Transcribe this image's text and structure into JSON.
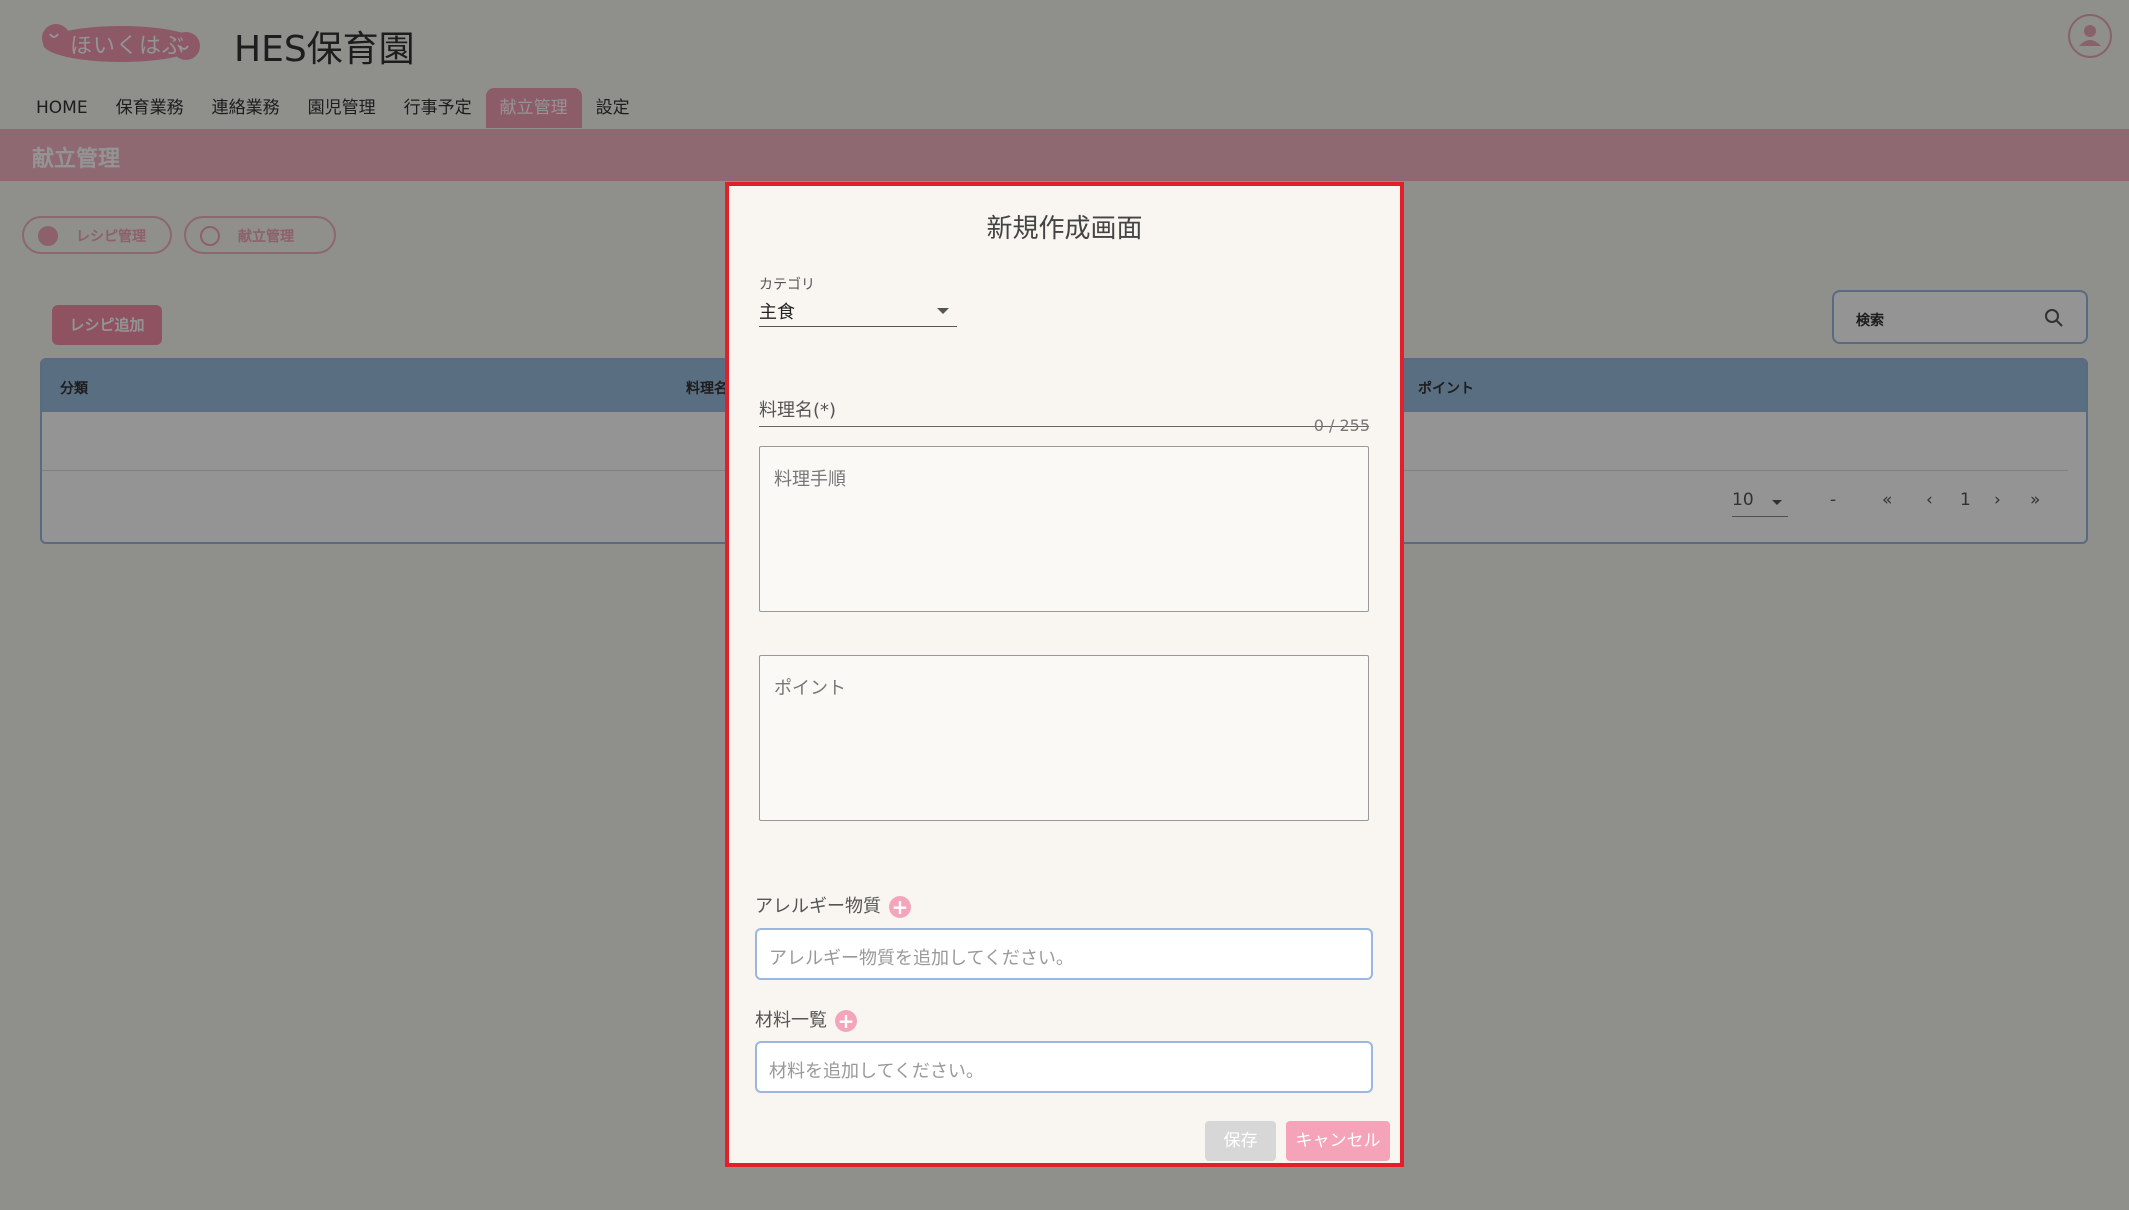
{
  "header": {
    "logo_text": "ほいくはぶ",
    "site_title": "HES保育園"
  },
  "nav": {
    "items": [
      {
        "label": "HOME",
        "active": false
      },
      {
        "label": "保育業務",
        "active": false
      },
      {
        "label": "連絡業務",
        "active": false
      },
      {
        "label": "園児管理",
        "active": false
      },
      {
        "label": "行事予定",
        "active": false
      },
      {
        "label": "献立管理",
        "active": true
      },
      {
        "label": "設定",
        "active": false
      }
    ]
  },
  "banner": {
    "title": "献立管理"
  },
  "subtabs": [
    {
      "label": "レシピ管理"
    },
    {
      "label": "献立管理"
    }
  ],
  "toolbar": {
    "add_recipe_label": "レシピ追加",
    "search_label": "検索"
  },
  "table": {
    "columns": [
      "分類",
      "料理名",
      "ポイント"
    ],
    "page_size": "10",
    "range_text": "-",
    "current_page": "1"
  },
  "modal": {
    "title": "新規作成画面",
    "category_label": "カテゴリ",
    "category_value": "主食",
    "dish_name_label": "料理名(*)",
    "dish_name_counter": "0 / 255",
    "procedure_placeholder": "料理手順",
    "point_placeholder": "ポイント",
    "allergen_label": "アレルギー物質",
    "allergen_placeholder": "アレルギー物質を追加してください。",
    "ingredients_label": "材料一覧",
    "ingredients_placeholder": "材料を追加してください。",
    "save_label": "保存",
    "cancel_label": "キャンセル"
  },
  "colors": {
    "accent_pink": "#f4a3b8",
    "highlight_border": "#e2202c",
    "table_header": "#9bbde0"
  }
}
